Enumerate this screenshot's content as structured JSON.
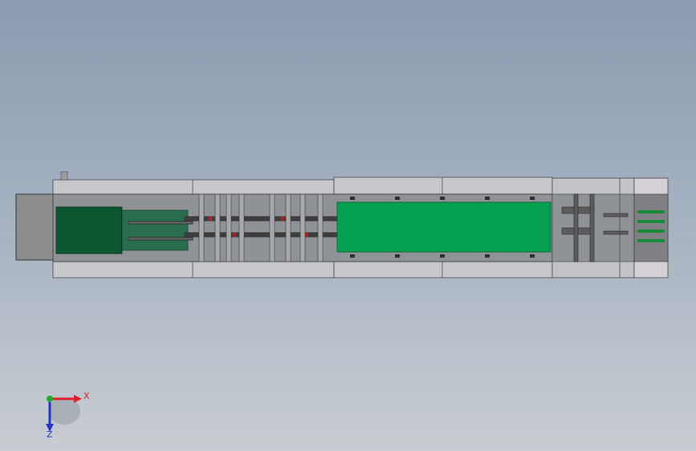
{
  "triad": {
    "x_label": "X",
    "z_label": "Z",
    "x_color": "#e0202a",
    "z_color": "#2436c8",
    "y_color": "#18b030"
  },
  "model": {
    "belt_dark_color": "#0b5530",
    "belt_light_color": "#05a04f",
    "frame_color": "#8f9296",
    "rail_color": "#c7c8cb",
    "end_block_color": "#d5d0d8"
  }
}
